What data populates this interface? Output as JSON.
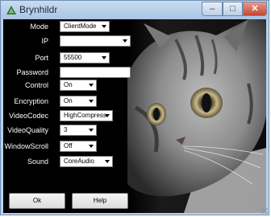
{
  "window": {
    "title": "Brynhildr",
    "icon": "brynhildr-app-icon",
    "controls": {
      "minimize": "–",
      "maximize": "□",
      "close": "✕"
    }
  },
  "form": {
    "mode": {
      "label": "Mode",
      "value": "ClientMode",
      "type": "select"
    },
    "ip": {
      "label": "IP",
      "value": "",
      "type": "select"
    },
    "port": {
      "label": "Port",
      "value": "55500",
      "type": "select"
    },
    "password": {
      "label": "Password",
      "value": "",
      "type": "input"
    },
    "control": {
      "label": "Control",
      "value": "On",
      "type": "select"
    },
    "encryption": {
      "label": "Encryption",
      "value": "On",
      "type": "select"
    },
    "videocodec": {
      "label": "VideoCodec",
      "value": "HighCompress",
      "type": "select"
    },
    "videoquality": {
      "label": "VideoQuality",
      "value": "3",
      "type": "select"
    },
    "windowscroll": {
      "label": "WindowScroll",
      "value": "Off",
      "type": "select"
    },
    "sound": {
      "label": "Sound",
      "value": "CoreAudio",
      "type": "select"
    }
  },
  "buttons": {
    "ok": "Ok",
    "help": "Help"
  },
  "image": {
    "subject": "cat-photo",
    "colors": {
      "fur": "#9a9a9a",
      "eye": "#c9b98a",
      "background": "#000000"
    }
  }
}
